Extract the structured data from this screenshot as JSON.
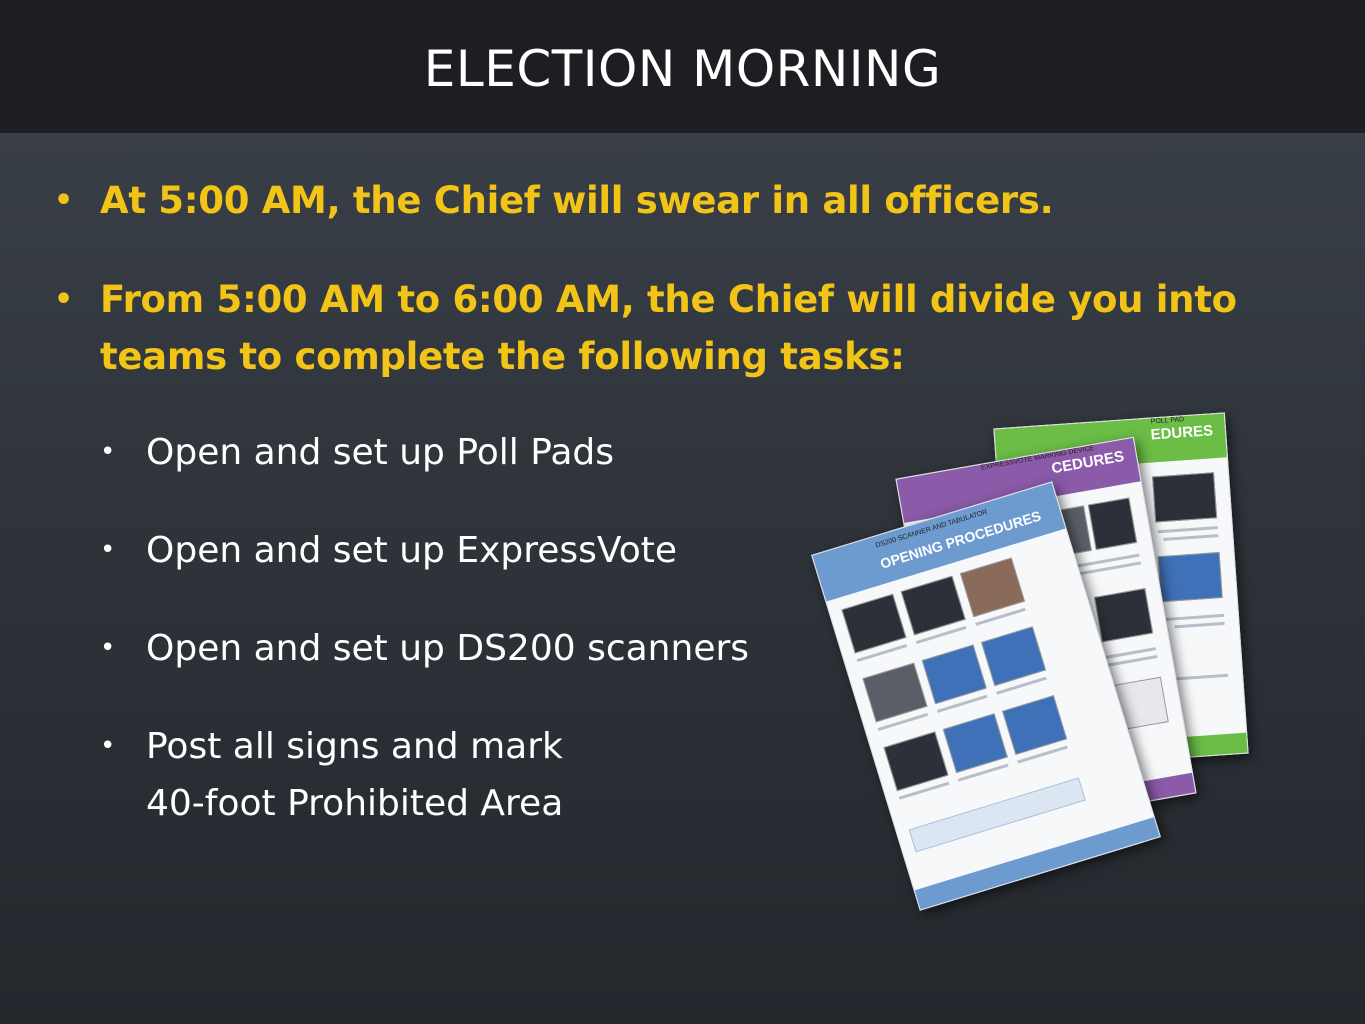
{
  "header": {
    "title": "ELECTION MORNING"
  },
  "main_bullets": [
    {
      "text": "At 5:00 AM, the Chief will swear in all officers."
    },
    {
      "line1": "From 5:00 AM to 6:00 AM, the Chief will divide you into",
      "line2": "teams to complete the following tasks:"
    }
  ],
  "tasks": [
    {
      "line1": "Open and set up Poll Pads"
    },
    {
      "line1": "Open and set up ExpressVote"
    },
    {
      "line1": "Open and set up DS200 scanners"
    },
    {
      "line1": "Post all signs and mark",
      "line2": "40-foot Prohibited Area"
    }
  ],
  "documents": [
    {
      "header_small": "POLL PAD",
      "header_label": "EDURES",
      "color": "#6bbd45"
    },
    {
      "header_small": "EXPRESSVOTE MARKING DEVICE",
      "header_label": "CEDURES",
      "color": "#8b5aa8"
    },
    {
      "header_small": "DS200 SCANNER AND TABULATOR",
      "header_label": "OPENING PROCEDURES",
      "color": "#6d9bd0"
    }
  ],
  "colors": {
    "accent": "#f2c417",
    "title_bar": "#1d1e21",
    "text": "#ffffff"
  }
}
